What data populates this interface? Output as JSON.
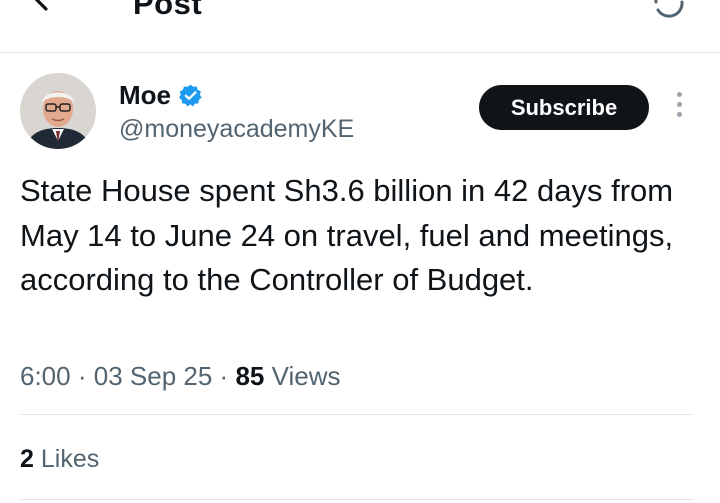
{
  "header": {
    "title": "Post",
    "back_icon": "arrow-left-icon",
    "refresh_icon": "refresh-icon"
  },
  "author": {
    "name": "Moe",
    "handle": "@moneyacademyKE",
    "verified": true,
    "verified_color": "#1d9bf0"
  },
  "actions": {
    "subscribe_label": "Subscribe",
    "more_icon": "more-vertical-icon"
  },
  "post": {
    "text": "State House spent Sh3.6 billion in 42 days from May 14 to June 24 on travel, fuel and meetings, according to the Controller of Budget.",
    "time": "6:00",
    "separator": "·",
    "date": "03 Sep 25",
    "views_count": "85",
    "views_label": "Views"
  },
  "engagement": {
    "likes_count": "2",
    "likes_label": "Likes"
  }
}
